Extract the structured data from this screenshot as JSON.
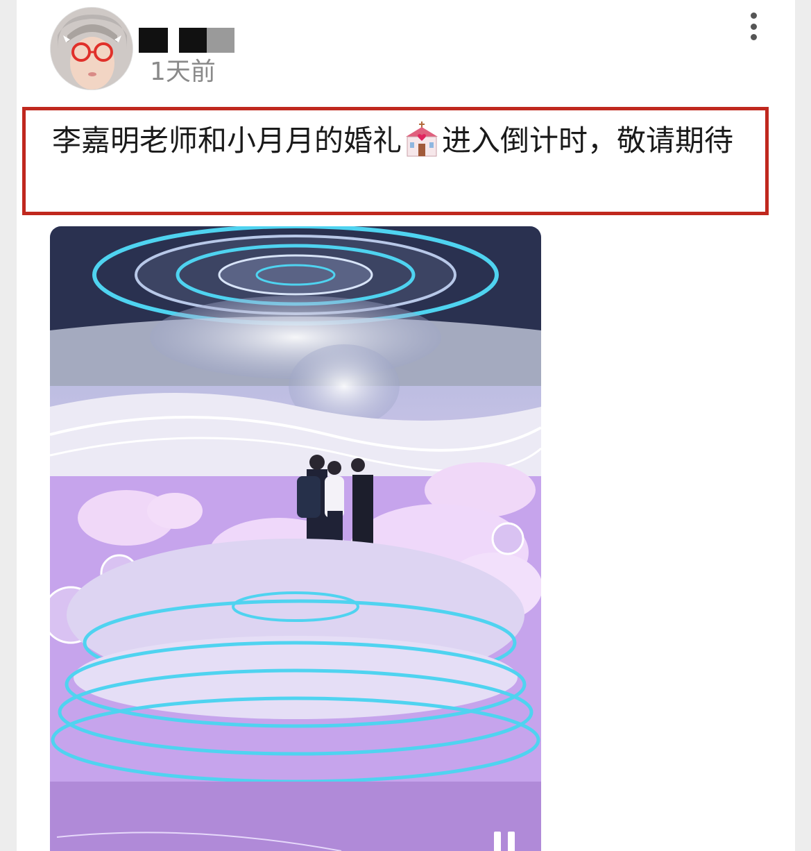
{
  "post": {
    "timestamp": "1天前",
    "text_before_emoji": "李嘉明老师和小月月的婚礼",
    "emoji": "wedding-chapel-emoji",
    "text_after_emoji": "进入倒计时，敬请期待",
    "highlight_color": "#c0281e"
  },
  "icons": {
    "more": "more-vertical-icon",
    "pause": "pause-icon"
  },
  "media": {
    "type": "video",
    "state": "playing"
  }
}
